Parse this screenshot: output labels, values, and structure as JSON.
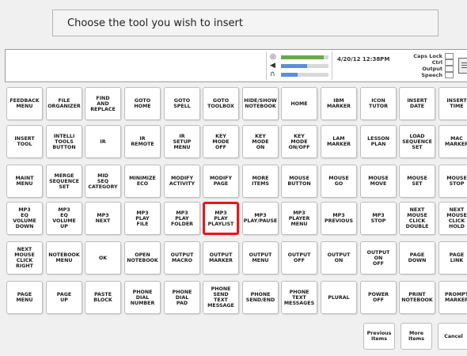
{
  "header": {
    "prompt": "Choose the tool you wish to insert"
  },
  "status": {
    "datetime": "4/20/12 12:38PM",
    "indicators": [
      {
        "label": "Caps Lock"
      },
      {
        "label": "Ctrl"
      },
      {
        "label": "Output"
      },
      {
        "label": "Speech"
      }
    ],
    "meters": [
      {
        "icon": "microphone-icon",
        "level": 0.9,
        "color": "#6aa84f"
      },
      {
        "icon": "speaker-icon",
        "level": 0.55,
        "color": "#5b8fd6"
      },
      {
        "icon": "headphones-icon",
        "level": 0.35,
        "color": "#5b8fd6"
      }
    ],
    "colors": {
      "meter_peak": "#e8171b",
      "meter_mid": "#f1c232"
    }
  },
  "tools": [
    [
      "FEEDBACK\nMENU",
      "FILE\nORGANIZER",
      "FIND\nAND\nREPLACE",
      "GOTO\nHOME",
      "GOTO\nSPELL",
      "GOTO\nTOOLBOX",
      "HIDE/SHOW\nNOTEBOOK",
      "HOME",
      "IBM\nMARKER",
      "ICON\nTUTOR",
      "INSERT\nDATE",
      "INSERT\nTIME"
    ],
    [
      "INSERT\nTOOL",
      "INTELLI\nTOOLS\nBUTTON",
      "IR",
      "IR\nREMOTE",
      "IR\nSETUP\nMENU",
      "KEY\nMODE\nOFF",
      "KEY\nMODE\nON",
      "KEY\nMODE\nON/OFF",
      "LAM\nMARKER",
      "LESSON\nPLAN",
      "LOAD\nSEQUENCE\nSET",
      "MAC\nMARKER"
    ],
    [
      "MAINT\nMENU",
      "MERGE\nSEQUENCE\nSET",
      "MID\nSEQ\nCATEGORY",
      "MINIMIZE\nECO",
      "MODIFY\nACTIVITY",
      "MODIFY\nPAGE",
      "MORE\nITEMS",
      "MOUSE\nBUTTON",
      "MOUSE\nGO",
      "MOUSE\nMOVE",
      "MOUSE\nSET",
      "MOUSE\nSTOP"
    ],
    [
      "MP3\nEQ\nVOLUME\nDOWN",
      "MP3\nEQ\nVOLUME\nUP",
      "MP3\nNEXT",
      "MP3\nPLAY\nFILE",
      "MP3\nPLAY\nFOLDER",
      "MP3\nPLAY\nPLAYLIST",
      "MP3\nPLAY/PAUSE",
      "MP3\nPLAYER\nMENU",
      "MP3\nPREVIOUS",
      "MP3\nSTOP",
      "NEXT\nMOUSE\nCLICK\nDOUBLE",
      "NEXT\nMOUSE\nCLICK\nHOLD"
    ],
    [
      "NEXT\nMOUSE\nCLICK\nRIGHT",
      "NOTEBOOK\nMENU",
      "OK",
      "OPEN\nNOTEBOOK",
      "OUTPUT\nMACRO",
      "OUTPUT\nMARKER",
      "OUTPUT\nMENU",
      "OUTPUT\nOFF",
      "OUTPUT\nON",
      "OUTPUT\nON\nOFF",
      "PAGE\nDOWN",
      "PAGE\nLINK"
    ],
    [
      "PAGE\nMENU",
      "PAGE\nUP",
      "PASTE\nBLOCK",
      "PHONE\nDIAL\nNUMBER",
      "PHONE\nDIAL\nPAD",
      "PHONE\nSEND\nTEXT\nMESSAGE",
      "PHONE\nSEND/END",
      "PHONE\nTEXT\nMESSAGES",
      "PLURAL",
      "POWER\nOFF",
      "PRINT\nNOTEBOOK",
      "PROMPT\nMARKER"
    ]
  ],
  "selected_tool": "MP3\nPLAY\nPLAYLIST",
  "footer": {
    "previous_label": "Previous\nItems",
    "more_label": "More\nItems",
    "cancel_label": "Cancel"
  }
}
